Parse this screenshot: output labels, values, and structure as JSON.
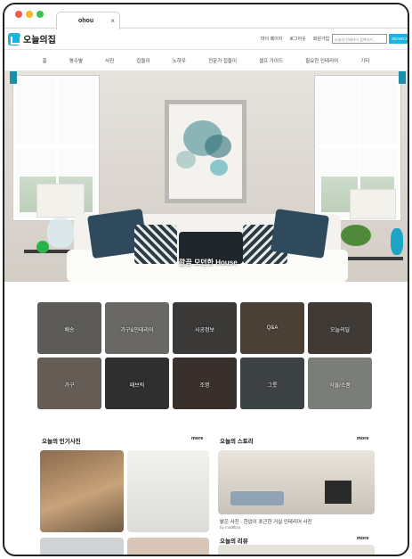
{
  "browser": {
    "tab_title": "ohou",
    "tab_close": "×",
    "traffic_colors": [
      "#f25a50",
      "#f5b928",
      "#3cc24c"
    ]
  },
  "header": {
    "logo_text": "오늘의집",
    "links": [
      "마이 페이지",
      "로그아웃",
      "회원가입"
    ],
    "search_placeholder": "오늘의 인테리어 검색하기...",
    "search_button": "SEARCH",
    "accent": "#1bb4e0"
  },
  "nav": {
    "items": [
      "홈",
      "평수별",
      "사진",
      "집들이",
      "노하우",
      "전문가 집들이",
      "셀프 가이드",
      "필요한 인테리어",
      "기타"
    ]
  },
  "hero": {
    "caption": "깔끔 모던한 House"
  },
  "categories": [
    {
      "label": "배송",
      "bg": "#5d5b58"
    },
    {
      "label": "가구&인테리어",
      "bg": "#6a6865"
    },
    {
      "label": "시공정보",
      "bg": "#3a3937"
    },
    {
      "label": "Q&A",
      "bg": "#4a4035"
    },
    {
      "label": "오늘의딜",
      "bg": "#3f3a35"
    },
    {
      "label": "가구",
      "bg": "#655d55"
    },
    {
      "label": "패브릭",
      "bg": "#2f2f2f"
    },
    {
      "label": "조명",
      "bg": "#3a302b"
    },
    {
      "label": "그릇",
      "bg": "#3c4244"
    },
    {
      "label": "식물/소품",
      "bg": "#7a7d78"
    }
  ],
  "sections": {
    "left_title": "오늘의 인기사진",
    "left_more": "more",
    "right_title": "오늘의 스토리",
    "right_more": "more",
    "story_caption": "밝은 사진 · 한없이 포근한 거실 인테리어 사진",
    "story_source": "by modfloor",
    "review_title": "오늘의 리뷰",
    "review_more": "more"
  }
}
